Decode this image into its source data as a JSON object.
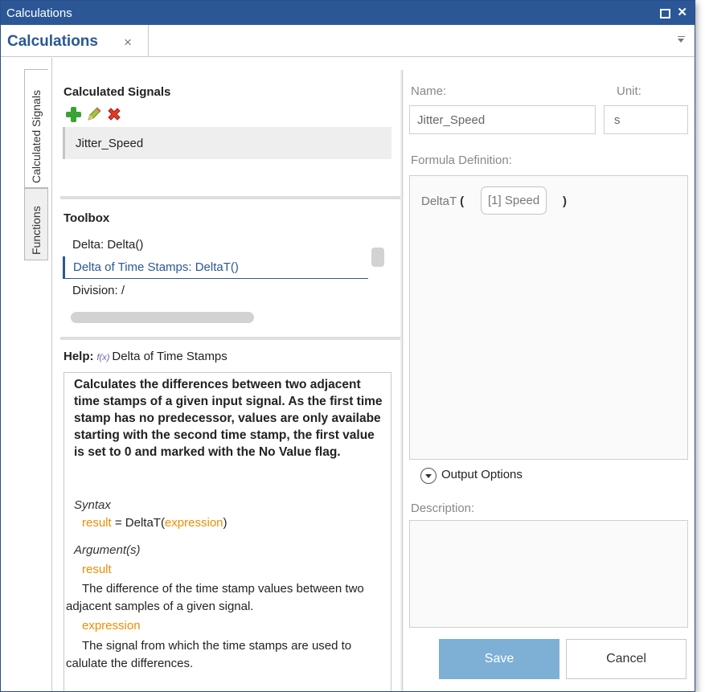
{
  "window": {
    "title": "Calculations"
  },
  "tab": {
    "label": "Calculations",
    "close_glyph": "×"
  },
  "side_tabs": [
    {
      "label": "Calculated Signals"
    },
    {
      "label": "Functions"
    }
  ],
  "calculated_signals": {
    "title": "Calculated Signals",
    "toolbar_icons": [
      "add-icon",
      "edit-icon",
      "delete-icon"
    ],
    "items": [
      {
        "label": "Jitter_Speed"
      }
    ]
  },
  "toolbox": {
    "title": "Toolbox",
    "items": [
      {
        "label": "Delta: Delta()"
      },
      {
        "label": "Delta of Time Stamps: DeltaT()",
        "selected": true
      },
      {
        "label": "Division:  /"
      }
    ]
  },
  "help": {
    "label": "Help:",
    "fx": "f(x)",
    "topic": "Delta of Time Stamps",
    "description": "Calculates the differences between two adjacent time stamps of a given input signal. As the first time stamp has no predecessor, values are only availabe starting with the second time stamp, the first value is set to 0 and marked with the No Value flag.",
    "syntax_heading": "Syntax",
    "syntax_result": "result",
    "syntax_eq": " = DeltaT(",
    "syntax_arg": "expression",
    "syntax_close": ")",
    "args_heading": "Argument(s)",
    "arg1_name": "result",
    "arg1_desc": "The difference of the time stamp values between two adjacent samples of a given signal.",
    "arg2_name": "expression",
    "arg2_desc": "The signal from which the time stamps are used to calulate the differences."
  },
  "editor": {
    "name_label": "Name:",
    "name_value": "Jitter_Speed",
    "unit_label": "Unit:",
    "unit_value": "s",
    "formula_label": "Formula Definition:",
    "formula_fn": "DeltaT",
    "formula_open": "(",
    "formula_arg": "[1] Speed",
    "formula_close": ")",
    "output_options": "Output Options",
    "description_label": "Description:",
    "save": "Save",
    "cancel": "Cancel"
  },
  "colors": {
    "titlebar": "#2b5797",
    "accent": "#2b5797",
    "save_button": "#7eb0d6",
    "help_orange": "#f28c00"
  }
}
